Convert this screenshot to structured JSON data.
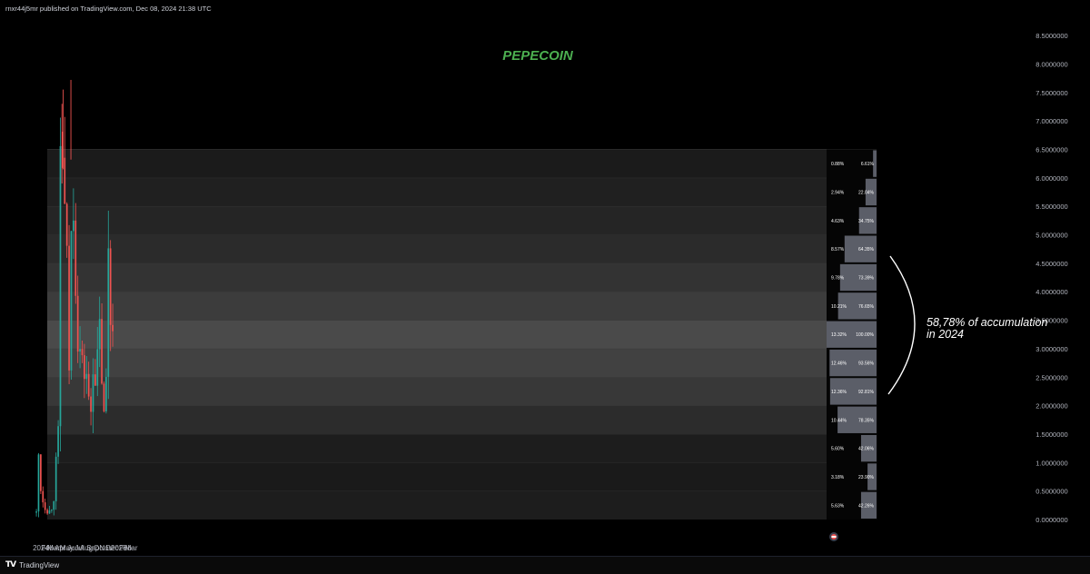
{
  "header": {
    "publisher": "rnxr44j5mr published on TradingView.com, Dec 08, 2024 21:38 UTC"
  },
  "footer": {
    "brand": "TradingView"
  },
  "colors": {
    "up": "#26a69a",
    "down": "#ef5350",
    "title": "#4caf50",
    "background": "#000000"
  },
  "chart_data": {
    "type": "candlestick",
    "title": "PEPECOIN",
    "annotation": "58,78% of accumulation\nin 2024",
    "y_axis": {
      "ticks": [
        "0.0000000",
        "0.5000000",
        "1.0000000",
        "1.5000000",
        "2.0000000",
        "2.5000000",
        "3.0000000",
        "3.5000000",
        "4.0000000",
        "4.5000000",
        "5.0000000",
        "5.5000000",
        "6.0000000",
        "6.5000000",
        "7.0000000",
        "7.5000000",
        "8.0000000",
        "8.5000000"
      ],
      "range": [
        0,
        8.5
      ]
    },
    "x_axis": {
      "labels": [
        {
          "label": "2024",
          "date": "2024-01-01"
        },
        {
          "label": "Feb",
          "date": "2024-02-01"
        },
        {
          "label": "Mar",
          "date": "2024-03-01"
        },
        {
          "label": "Apr",
          "date": "2024-04-01"
        },
        {
          "label": "May",
          "date": "2024-05-01"
        },
        {
          "label": "Jun",
          "date": "2024-06-01"
        },
        {
          "label": "Jul",
          "date": "2024-07-01"
        },
        {
          "label": "Aug",
          "date": "2024-08-01"
        },
        {
          "label": "Sep",
          "date": "2024-09-01"
        },
        {
          "label": "Oct",
          "date": "2024-10-01"
        },
        {
          "label": "Nov",
          "date": "2024-11-01"
        },
        {
          "label": "Dec",
          "date": "2024-12-01"
        },
        {
          "label": "2025",
          "date": "2025-01-01"
        },
        {
          "label": "Feb",
          "date": "2025-02-01"
        },
        {
          "label": "Mar",
          "date": "2025-03-01"
        }
      ]
    },
    "series": [
      {
        "points": [
          [
            "2023-12-11",
            0.12
          ],
          [
            "2023-12-14",
            0.7
          ],
          [
            "2023-12-18",
            0.9
          ],
          [
            "2023-12-21",
            1.15
          ],
          [
            "2023-12-24",
            0.95
          ],
          [
            "2023-12-27",
            0.7
          ],
          [
            "2023-12-31",
            0.55
          ],
          [
            "2024-01-04",
            0.45
          ],
          [
            "2024-01-08",
            0.38
          ],
          [
            "2024-01-12",
            0.3
          ],
          [
            "2024-01-16",
            0.25
          ],
          [
            "2024-01-20",
            0.22
          ],
          [
            "2024-01-25",
            0.17
          ],
          [
            "2024-01-30",
            0.14
          ],
          [
            "2024-02-05",
            0.18
          ],
          [
            "2024-02-10",
            0.15
          ],
          [
            "2024-02-15",
            0.14
          ],
          [
            "2024-02-20",
            0.2
          ],
          [
            "2024-02-25",
            0.27
          ],
          [
            "2024-03-01",
            0.35
          ],
          [
            "2024-03-05",
            0.45
          ],
          [
            "2024-03-09",
            0.7
          ],
          [
            "2024-03-13",
            1.1
          ],
          [
            "2024-03-16",
            1.5
          ],
          [
            "2024-03-19",
            1.8
          ],
          [
            "2024-03-22",
            1.35
          ],
          [
            "2024-03-25",
            2.6
          ],
          [
            "2024-03-28",
            4.5
          ],
          [
            "2024-03-31",
            6.0
          ],
          [
            "2024-04-03",
            6.8
          ],
          [
            "2024-04-06",
            6.2
          ],
          [
            "2024-04-09",
            5.6
          ],
          [
            "2024-04-12",
            6.5
          ],
          [
            "2024-04-15",
            7.3
          ],
          [
            "2024-04-18",
            6.2
          ],
          [
            "2024-04-21",
            5.5
          ],
          [
            "2024-04-24",
            5.2
          ],
          [
            "2024-04-27",
            5.4
          ],
          [
            "2024-04-30",
            5.0
          ],
          [
            "2024-05-03",
            4.4
          ],
          [
            "2024-05-06",
            3.4
          ],
          [
            "2024-05-10",
            2.8
          ],
          [
            "2024-05-14",
            2.6
          ],
          [
            "2024-05-18",
            3.2
          ],
          [
            "2024-05-22",
            4.8
          ],
          [
            "2024-05-25",
            5.3
          ],
          [
            "2024-05-28",
            4.7
          ],
          [
            "2024-05-31",
            5.9
          ],
          [
            "2024-06-03",
            5.5
          ],
          [
            "2024-06-07",
            5.2
          ],
          [
            "2024-06-11",
            4.4
          ],
          [
            "2024-06-15",
            3.8
          ],
          [
            "2024-06-19",
            3.3
          ],
          [
            "2024-06-24",
            3.1
          ],
          [
            "2024-06-29",
            3.2
          ],
          [
            "2024-07-04",
            2.9
          ],
          [
            "2024-07-09",
            3.3
          ],
          [
            "2024-07-14",
            2.6
          ],
          [
            "2024-07-19",
            2.3
          ],
          [
            "2024-07-24",
            2.6
          ],
          [
            "2024-07-29",
            2.9
          ],
          [
            "2024-08-02",
            2.6
          ],
          [
            "2024-08-07",
            2.25
          ],
          [
            "2024-08-12",
            2.1
          ],
          [
            "2024-08-17",
            1.9
          ],
          [
            "2024-08-22",
            1.8
          ],
          [
            "2024-08-27",
            2.3
          ],
          [
            "2024-09-01",
            2.6
          ],
          [
            "2024-09-06",
            3.1
          ],
          [
            "2024-09-11",
            2.6
          ],
          [
            "2024-09-16",
            2.3
          ],
          [
            "2024-09-21",
            2.6
          ],
          [
            "2024-09-26",
            3.2
          ],
          [
            "2024-10-01",
            3.5
          ],
          [
            "2024-10-05",
            3.2
          ],
          [
            "2024-10-09",
            2.9
          ],
          [
            "2024-10-13",
            2.5
          ],
          [
            "2024-10-17",
            2.2
          ],
          [
            "2024-10-21",
            1.9
          ],
          [
            "2024-10-25",
            1.75
          ],
          [
            "2024-10-29",
            1.9
          ],
          [
            "2024-11-02",
            2.5
          ],
          [
            "2024-11-05",
            2.2
          ],
          [
            "2024-11-08",
            2.8
          ],
          [
            "2024-11-11",
            4.6
          ],
          [
            "2024-11-14",
            5.0
          ],
          [
            "2024-11-17",
            4.3
          ],
          [
            "2024-11-20",
            3.8
          ],
          [
            "2024-11-23",
            3.5
          ],
          [
            "2024-11-26",
            3.4
          ],
          [
            "2024-11-29",
            3.9
          ],
          [
            "2024-12-02",
            3.2
          ],
          [
            "2024-12-05",
            4.1
          ],
          [
            "2024-12-08",
            3.6
          ]
        ]
      }
    ],
    "volume_profile": [
      {
        "low": 0.0,
        "high": 0.5,
        "left": "5.63%",
        "right": "42.26%",
        "fill": 0.31
      },
      {
        "low": 0.5,
        "high": 1.0,
        "left": "3.18%",
        "right": "23.90%",
        "fill": 0.18
      },
      {
        "low": 1.0,
        "high": 1.5,
        "left": "5.60%",
        "right": "42.06%",
        "fill": 0.31
      },
      {
        "low": 1.5,
        "high": 2.0,
        "left": "10.44%",
        "right": "78.35%",
        "fill": 0.78
      },
      {
        "low": 2.0,
        "high": 2.5,
        "left": "12.36%",
        "right": "92.81%",
        "fill": 0.93
      },
      {
        "low": 2.5,
        "high": 3.0,
        "left": "12.46%",
        "right": "93.56%",
        "fill": 0.94
      },
      {
        "low": 3.0,
        "high": 3.5,
        "left": "13.32%",
        "right": "100.00%",
        "fill": 1.0
      },
      {
        "low": 3.5,
        "high": 4.0,
        "left": "10.21%",
        "right": "76.65%",
        "fill": 0.77
      },
      {
        "low": 4.0,
        "high": 4.5,
        "left": "9.78%",
        "right": "73.39%",
        "fill": 0.73
      },
      {
        "low": 4.5,
        "high": 5.0,
        "left": "8.57%",
        "right": "64.35%",
        "fill": 0.64
      },
      {
        "low": 5.0,
        "high": 5.5,
        "left": "4.63%",
        "right": "34.75%",
        "fill": 0.35
      },
      {
        "low": 5.5,
        "high": 6.0,
        "left": "2.94%",
        "right": "22.04%",
        "fill": 0.22
      },
      {
        "low": 6.0,
        "high": 6.5,
        "left": "0.88%",
        "right": "6.61%",
        "fill": 0.07
      }
    ]
  }
}
